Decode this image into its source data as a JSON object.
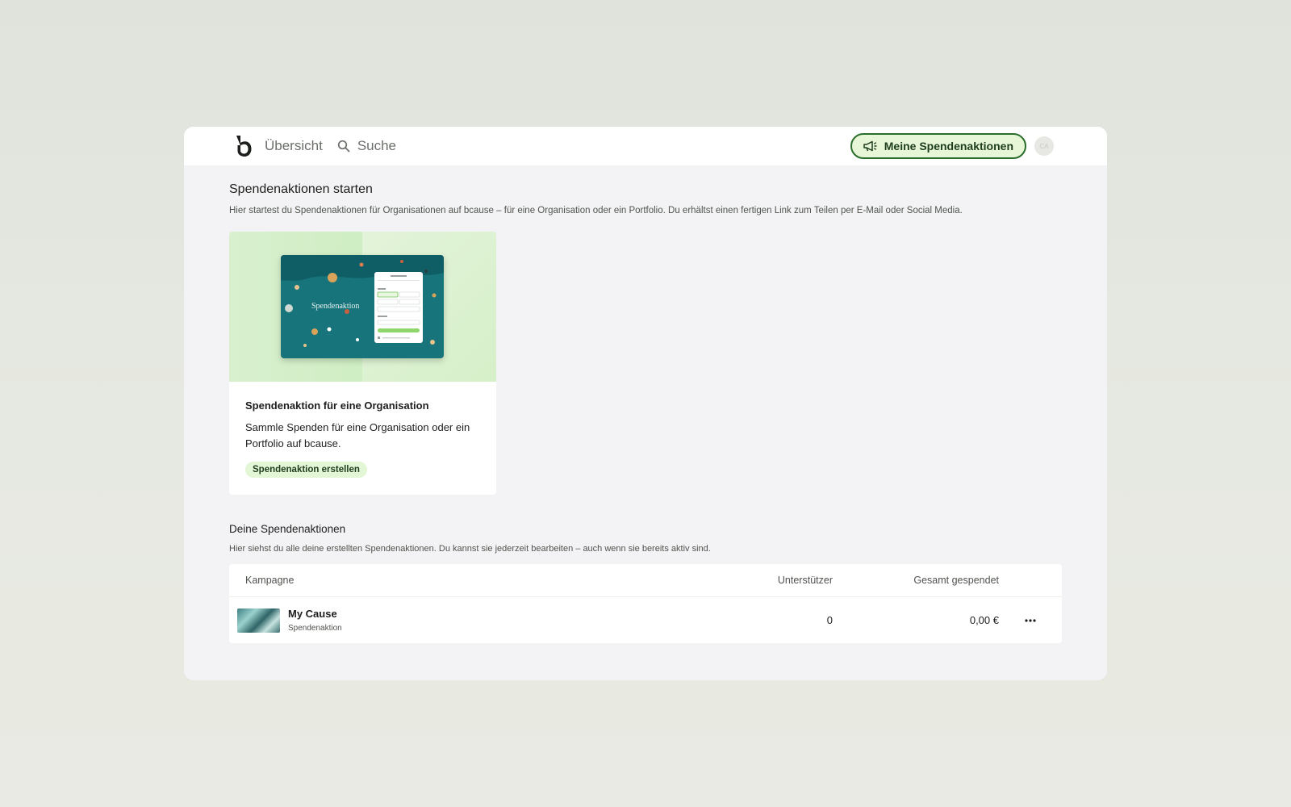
{
  "nav": {
    "overview_label": "Übersicht",
    "search_label": "Suche",
    "my_campaigns_label": "Meine Spendenaktionen",
    "avatar_initials": "CA"
  },
  "start": {
    "title": "Spendenaktionen starten",
    "description": "Hier startest du Spendenaktionen für Organisationen auf bcause – für eine Organisation oder ein Portfolio. Du erhältst einen fertigen Link zum Teilen per E-Mail oder Social Media."
  },
  "card": {
    "preview_title": "Spendenaktion",
    "title": "Spendenaktion für eine Organisation",
    "description": "Sammle Spenden für eine Organisation oder ein Portfolio auf bcause.",
    "cta": "Spendenaktion erstellen"
  },
  "mine": {
    "title": "Deine Spendenaktionen",
    "description": "Hier siehst du alle deine erstellten Spendenaktionen. Du kannst sie jederzeit bearbeiten – auch wenn sie bereits aktiv sind."
  },
  "table": {
    "headers": {
      "campaign": "Kampagne",
      "supporters": "Unterstützer",
      "total": "Gesamt gespendet"
    },
    "rows": [
      {
        "name": "My Cause",
        "type": "Spendenaktion",
        "supporters": "0",
        "total": "0,00 €"
      }
    ]
  },
  "colors": {
    "accent": "#2b6e2c",
    "accent_bg": "#e6f6d6",
    "teal": "#17747b"
  },
  "icons": [
    "logo-icon",
    "search-icon",
    "megaphone-icon",
    "more-icon"
  ]
}
